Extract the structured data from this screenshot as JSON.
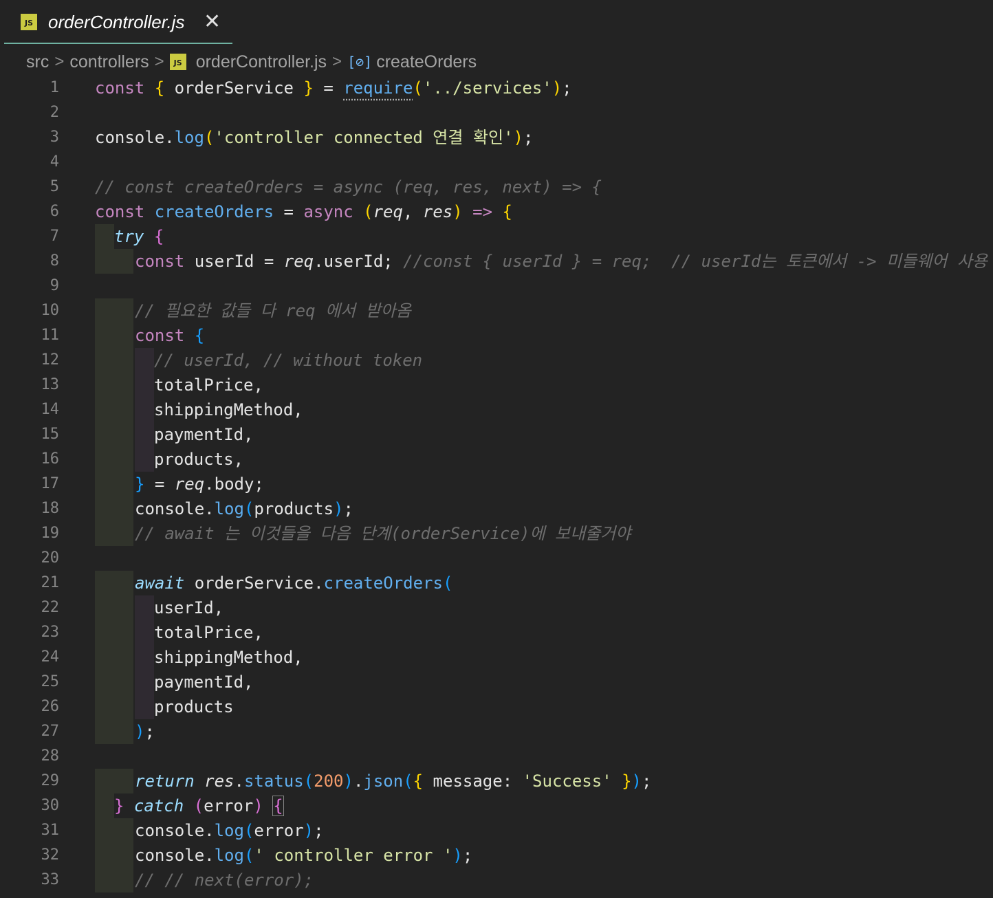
{
  "tab": {
    "icon_label": "JS",
    "title": "orderController.js",
    "close": "✕"
  },
  "breadcrumb": {
    "items": [
      "src",
      "controllers",
      "orderController.js",
      "createOrders"
    ],
    "separator": ">",
    "method_icon": "[⊘]"
  },
  "line_numbers": [
    "1",
    "2",
    "3",
    "4",
    "5",
    "6",
    "7",
    "8",
    "9",
    "10",
    "11",
    "12",
    "13",
    "14",
    "15",
    "16",
    "17",
    "18",
    "19",
    "20",
    "21",
    "22",
    "23",
    "24",
    "25",
    "26",
    "27",
    "28",
    "29",
    "30",
    "31",
    "32",
    "33"
  ],
  "code": {
    "l1": [
      "const ",
      "{",
      " orderService ",
      "}",
      " = ",
      "require",
      "(",
      "'../services'",
      ")",
      ";"
    ],
    "l3": [
      "console",
      ".",
      "log",
      "(",
      "'controller connected 연결 확인'",
      ")",
      ";"
    ],
    "l5": [
      "// const createOrders = async (req, res, next) => {"
    ],
    "l6": [
      "const ",
      "createOrders",
      " = ",
      "async",
      " ",
      "(",
      "req",
      ", ",
      "res",
      ")",
      " => ",
      "{"
    ],
    "l7": [
      "try",
      " ",
      "{"
    ],
    "l8": [
      "const ",
      "userId",
      " = ",
      "req",
      ".userId;",
      " //const { userId } = req;  // userId는 토큰에서 -> 미들웨어 사용"
    ],
    "l10": [
      "// 필요한 값들 다 req 에서 받아옴"
    ],
    "l11": [
      "const ",
      "{"
    ],
    "l12": [
      "// userId, // without token"
    ],
    "l13": [
      "totalPrice,"
    ],
    "l14": [
      "shippingMethod,"
    ],
    "l15": [
      "paymentId,"
    ],
    "l16": [
      "products,"
    ],
    "l17": [
      "}",
      " = ",
      "req",
      ".body;"
    ],
    "l18": [
      "console",
      ".",
      "log",
      "(",
      "products",
      ")",
      ";"
    ],
    "l19": [
      "// await 는 이것들을 다음 단계(orderService)에 보내줄거야"
    ],
    "l21": [
      "await",
      " orderService.",
      "createOrders",
      "("
    ],
    "l22": [
      "userId,"
    ],
    "l23": [
      "totalPrice,"
    ],
    "l24": [
      "shippingMethod,"
    ],
    "l25": [
      "paymentId,"
    ],
    "l26": [
      "products"
    ],
    "l27": [
      ")",
      ";"
    ],
    "l29": [
      "return",
      " ",
      "res",
      ".",
      "status",
      "(",
      "200",
      ")",
      ".",
      "json",
      "(",
      "{",
      " message: ",
      "'Success'",
      " ",
      "}",
      ")",
      ";"
    ],
    "l30": [
      "}",
      " ",
      "catch",
      " ",
      "(",
      "error",
      ")",
      " ",
      "{"
    ],
    "l31": [
      "console",
      ".",
      "log",
      "(",
      "error",
      ")",
      ";"
    ],
    "l32": [
      "console",
      ".",
      "log",
      "(",
      "' controller error '",
      ")",
      ";"
    ],
    "l33": [
      "// // next(error);"
    ]
  },
  "colors": {
    "background": "#232323",
    "tab_underline": "#6fb2a2",
    "js_icon": "#cbcb41",
    "keyword": "#c586c0",
    "function": "#61afef",
    "string": "#d7e4a6",
    "comment": "#6e6e6e",
    "number": "#f39c6b"
  }
}
